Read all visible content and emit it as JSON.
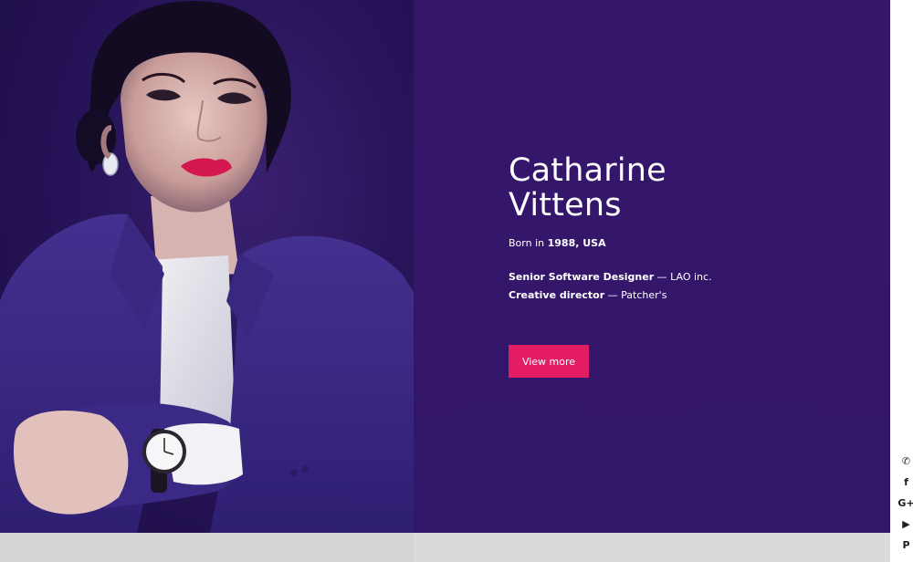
{
  "menu": {
    "icon": "hamburger-menu-icon"
  },
  "hero": {
    "name_line1": "Catharine",
    "name_line2": "Vittens",
    "born_prefix": "Born in",
    "born_year": "1988, USA",
    "roles": [
      {
        "title": "Senior Software Designer",
        "separator": " — ",
        "org": "LAO inc."
      },
      {
        "title": "Creative director",
        "separator": " — ",
        "org": "Patcher's"
      }
    ],
    "cta_label": "View more"
  },
  "social": [
    {
      "icon": "whatsapp-icon",
      "glyph": "✆"
    },
    {
      "icon": "facebook-icon",
      "glyph": "f"
    },
    {
      "icon": "google-plus-icon",
      "glyph": "G+"
    },
    {
      "icon": "youtube-icon",
      "glyph": "▶"
    },
    {
      "icon": "pinterest-icon",
      "glyph": "P"
    }
  ],
  "colors": {
    "hero_bg": "#32166a",
    "photo_bg": "#28145a",
    "suit": "#3d2a86",
    "accent": "#e41c64",
    "text": "#ffffff",
    "footer_strip": "#d9dbda"
  }
}
